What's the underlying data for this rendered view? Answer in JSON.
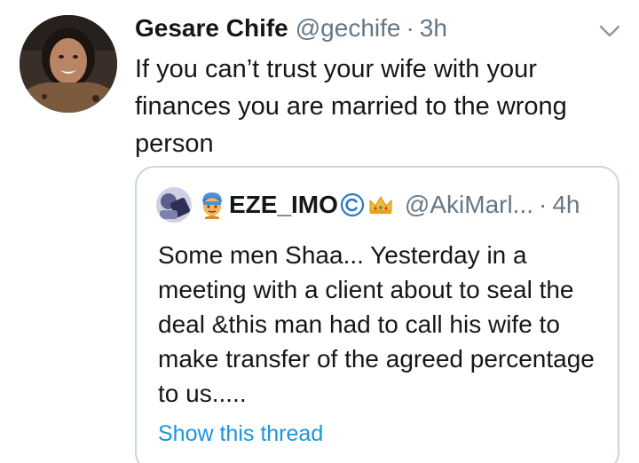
{
  "tweet": {
    "author_name": "Gesare Chife",
    "author_handle": "@gechife",
    "separator": "·",
    "time": "3h",
    "text": "If you can’t trust your wife with your finances you are married to the wrong person",
    "menu_icon": "chevron-down-icon"
  },
  "quote": {
    "name": "EZE_IMO",
    "name_prefix_emoji": "man-with-turban",
    "badge_icon": "copyright-icon",
    "suffix_emoji": "crown",
    "handle": "@AkiMarl...",
    "separator": "·",
    "time": "4h",
    "text": "Some men Shaa... Yesterday in a meeting with a client about to seal the deal &this man had to call his wife to make transfer of the agreed percentage to us.....",
    "show_thread": "Show this thread"
  },
  "colors": {
    "text_primary": "#14171a",
    "text_secondary": "#657786",
    "link": "#1b95e0",
    "border": "#ccd6dd"
  }
}
